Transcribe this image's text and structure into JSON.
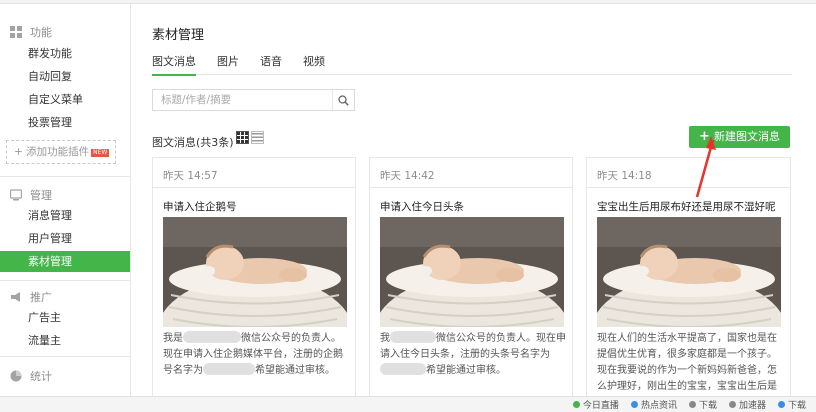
{
  "sidebar": {
    "sections": [
      {
        "label": "功能",
        "icon": "grid-icon",
        "items": [
          {
            "label": "群发功能"
          },
          {
            "label": "自动回复"
          },
          {
            "label": "自定义菜单"
          },
          {
            "label": "投票管理"
          }
        ]
      },
      {
        "label": "管理",
        "icon": "monitor-icon",
        "items": [
          {
            "label": "消息管理"
          },
          {
            "label": "用户管理"
          },
          {
            "label": "素材管理",
            "active": true
          }
        ]
      },
      {
        "label": "推广",
        "icon": "megaphone-icon",
        "items": [
          {
            "label": "广告主"
          },
          {
            "label": "流量主"
          }
        ]
      },
      {
        "label": "统计",
        "icon": "chart-pie-icon",
        "items": []
      }
    ],
    "add_plugin_label": "+ 添加功能插件",
    "new_badge": "NEW"
  },
  "main": {
    "title": "素材管理",
    "tabs": [
      {
        "label": "图文消息",
        "active": true
      },
      {
        "label": "图片"
      },
      {
        "label": "语音"
      },
      {
        "label": "视频"
      }
    ],
    "search_placeholder": "标题/作者/摘要",
    "count_label": "图文消息(共3条)",
    "new_button_label": "新建图文消息",
    "cards": [
      {
        "time": "昨天 14:57",
        "title": "申请入住企鹅号",
        "desc_a": "我是",
        "desc_b": "微信公众号的负责人。现在申请入住企鹅媒体平台，注册的企鹅号名字为",
        "desc_c": "希望能通过审核。"
      },
      {
        "time": "昨天 14:42",
        "title": "申请入住今日头条",
        "desc_a": "我",
        "desc_b": "微信公众号的负责人。现在申请入住今日头条，注册的头条号名字为",
        "desc_c": "希望能通过审核。"
      },
      {
        "time": "昨天 14:18",
        "title": "宝宝出生后用尿布好还是用尿不湿好呢",
        "desc_full": "现在人们的生活水平提高了，国家也是在提倡优生优育，很多家庭都是一个孩子。现在我要说的作为一个新妈妈新爸爸，怎么护理好，刚出生的宝宝，宝宝出生后是用尿布"
      }
    ]
  },
  "statusbar": {
    "items": [
      "今日直播",
      "热点资讯",
      "下载",
      "加速器",
      "下载"
    ]
  },
  "colors": {
    "accent": "#44b549",
    "arrow": "#e8322c"
  }
}
